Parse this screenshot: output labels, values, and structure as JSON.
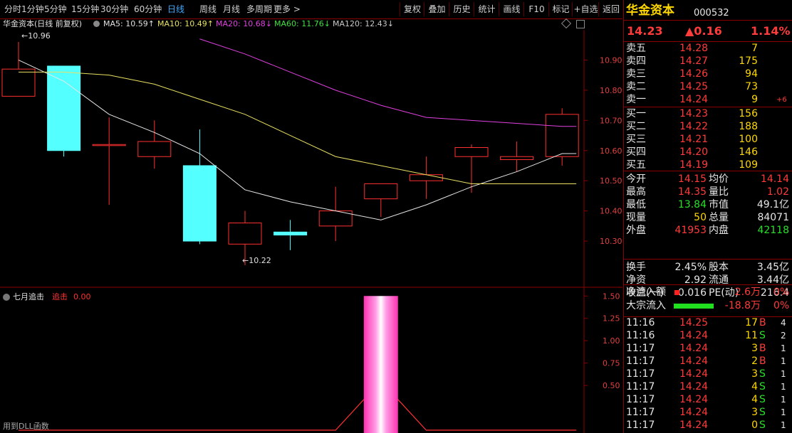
{
  "toolbar": {
    "periods": [
      "分时",
      "1分钟",
      "5分钟",
      "15分钟",
      "30分钟",
      "60分钟",
      "日线",
      "周线",
      "月线",
      "多周期",
      "更多 >"
    ],
    "active_period": "日线",
    "buttons": [
      "复权",
      "叠加",
      "历史",
      "统计",
      "画线",
      "F10",
      "标记",
      "+自选",
      "返回"
    ]
  },
  "legend": {
    "name": "华金资本(日线 前复权)",
    "ma5": "MA5: 10.59↑",
    "ma10": "MA10: 10.49↑",
    "ma20": "MA20: 10.68↓",
    "ma60": "MA60: 11.76↓",
    "ma120": "MA120: 12.43↓"
  },
  "chart_data": [
    {
      "type": "candlestick",
      "y_ticks": [
        "10.90",
        "10.80",
        "10.70",
        "10.60",
        "10.50",
        "10.40",
        "10.30"
      ],
      "ylim": [
        10.18,
        11.0
      ],
      "annotations": {
        "high": "10.96",
        "low": "10.22"
      },
      "candles": [
        {
          "o": 10.78,
          "c": 10.87,
          "h": 10.96,
          "l": 10.78
        },
        {
          "o": 10.88,
          "c": 10.6,
          "h": 10.88,
          "l": 10.58
        },
        {
          "o": 10.62,
          "c": 10.62,
          "h": 10.71,
          "l": 10.42
        },
        {
          "o": 10.58,
          "c": 10.63,
          "h": 10.7,
          "l": 10.54
        },
        {
          "o": 10.55,
          "c": 10.3,
          "h": 10.67,
          "l": 10.29
        },
        {
          "o": 10.29,
          "c": 10.36,
          "h": 10.4,
          "l": 10.22
        },
        {
          "o": 10.33,
          "c": 10.32,
          "h": 10.37,
          "l": 10.27
        },
        {
          "o": 10.35,
          "c": 10.4,
          "h": 10.48,
          "l": 10.3
        },
        {
          "o": 10.44,
          "c": 10.49,
          "h": 10.49,
          "l": 10.38
        },
        {
          "o": 10.5,
          "c": 10.52,
          "h": 10.58,
          "l": 10.44
        },
        {
          "o": 10.58,
          "c": 10.61,
          "h": 10.62,
          "l": 10.46
        },
        {
          "o": 10.57,
          "c": 10.58,
          "h": 10.63,
          "l": 10.53
        },
        {
          "o": 10.58,
          "c": 10.72,
          "h": 10.74,
          "l": 10.55
        }
      ],
      "series": [
        {
          "name": "MA5",
          "color": "#e6e6e6",
          "values": [
            10.9,
            10.83,
            10.72,
            10.66,
            10.59,
            10.47,
            10.43,
            10.4,
            10.37,
            10.42,
            10.48,
            10.53,
            10.59
          ]
        },
        {
          "name": "MA10",
          "color": "#e8e060",
          "values": [
            10.86,
            10.86,
            10.85,
            10.82,
            10.77,
            10.72,
            10.65,
            10.58,
            10.55,
            10.52,
            10.49,
            10.49,
            10.49
          ]
        },
        {
          "name": "MA20",
          "color": "#e040e0",
          "values": [
            null,
            null,
            null,
            null,
            10.97,
            10.92,
            10.86,
            10.8,
            10.75,
            10.71,
            10.7,
            10.69,
            10.68
          ]
        }
      ]
    },
    {
      "type": "line",
      "title": "七月追击",
      "signal_label": "追击",
      "signal_value": "0.00",
      "y_ticks": [
        "1.50",
        "1.25",
        "1.00",
        "0.75",
        "0.50"
      ],
      "ylim": [
        0,
        1.55
      ],
      "values": [
        0,
        0,
        0,
        0,
        0,
        0,
        0,
        0,
        1.5,
        0,
        0,
        0,
        0
      ],
      "footer": "用到DLL函数"
    }
  ],
  "quote": {
    "name": "华金资本",
    "code": "000532",
    "price": "14.23",
    "change": "▲0.16",
    "pct": "1.14%",
    "asks": [
      {
        "label": "卖五",
        "price": "14.28",
        "vol": "7",
        "extra": ""
      },
      {
        "label": "卖四",
        "price": "14.27",
        "vol": "175",
        "extra": ""
      },
      {
        "label": "卖三",
        "price": "14.26",
        "vol": "94",
        "extra": ""
      },
      {
        "label": "卖二",
        "price": "14.25",
        "vol": "73",
        "extra": ""
      },
      {
        "label": "卖一",
        "price": "14.24",
        "vol": "9",
        "extra": "+6"
      }
    ],
    "bids": [
      {
        "label": "买一",
        "price": "14.23",
        "vol": "156"
      },
      {
        "label": "买二",
        "price": "14.22",
        "vol": "188"
      },
      {
        "label": "买三",
        "price": "14.21",
        "vol": "100"
      },
      {
        "label": "买四",
        "price": "14.20",
        "vol": "146"
      },
      {
        "label": "买五",
        "price": "14.19",
        "vol": "109"
      }
    ],
    "stats": [
      {
        "l1": "今开",
        "v1": "14.15",
        "c1": "red",
        "l2": "均价",
        "v2": "14.14",
        "c2": "red"
      },
      {
        "l1": "最高",
        "v1": "14.35",
        "c1": "red",
        "l2": "量比",
        "v2": "1.02",
        "c2": "red"
      },
      {
        "l1": "最低",
        "v1": "13.84",
        "c1": "green",
        "l2": "市值",
        "v2": "49.1亿",
        "c2": "white"
      },
      {
        "l1": "现量",
        "v1": "50",
        "c1": "yellow",
        "l2": "总量",
        "v2": "84071",
        "c2": "white"
      },
      {
        "l1": "外盘",
        "v1": "41953",
        "c1": "red",
        "l2": "内盘",
        "v2": "42118",
        "c2": "green"
      }
    ],
    "stats2": [
      {
        "l1": "换手",
        "v1": "2.45%",
        "l2": "股本",
        "v2": "3.45亿"
      },
      {
        "l1": "净资",
        "v1": "2.92",
        "l2": "流通",
        "v2": "3.44亿"
      },
      {
        "l1": "收益(一)",
        "v1": "0.016",
        "l2": "PE(动)",
        "v2": "216.4"
      }
    ],
    "flow": [
      {
        "label": "净流入额",
        "value": "2.6万",
        "pct": "0%",
        "bar": "red"
      },
      {
        "label": "大宗流入",
        "value": "-18.8万",
        "pct": "0%",
        "bar": "green"
      }
    ],
    "ticks": [
      {
        "t": "11:16",
        "p": "14.25",
        "v": "17",
        "s": "B",
        "n": "4"
      },
      {
        "t": "11:16",
        "p": "14.24",
        "v": "11",
        "s": "S",
        "n": "2"
      },
      {
        "t": "11:17",
        "p": "14.24",
        "v": "3",
        "s": "B",
        "n": "1"
      },
      {
        "t": "11:17",
        "p": "14.24",
        "v": "2",
        "s": "B",
        "n": "1"
      },
      {
        "t": "11:17",
        "p": "14.24",
        "v": "3",
        "s": "S",
        "n": "1"
      },
      {
        "t": "11:17",
        "p": "14.24",
        "v": "4",
        "s": "S",
        "n": "1"
      },
      {
        "t": "11:17",
        "p": "14.24",
        "v": "4",
        "s": "S",
        "n": "1"
      },
      {
        "t": "11:17",
        "p": "14.24",
        "v": "3",
        "s": "S",
        "n": "1"
      },
      {
        "t": "11:17",
        "p": "14.24",
        "v": "0",
        "s": "S",
        "n": "1"
      }
    ]
  },
  "colors": {
    "up": "#ff3030",
    "down": "#54ffff",
    "grid": "#8b0000",
    "signal": "#ff40c0"
  }
}
